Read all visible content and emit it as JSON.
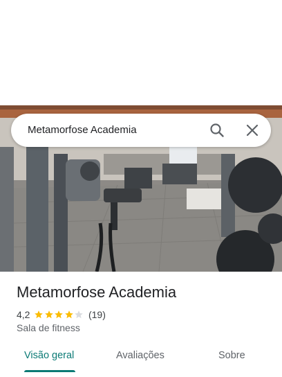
{
  "search": {
    "query": "Metamorfose Academia"
  },
  "place": {
    "name": "Metamorfose Academia",
    "rating": "4,2",
    "stars_filled": 4,
    "stars_total": 5,
    "review_count": "(19)",
    "category": "Sala de fitness"
  },
  "tabs": [
    {
      "label": "Visão geral",
      "active": true
    },
    {
      "label": "Avaliações",
      "active": false
    },
    {
      "label": "Sobre",
      "active": false
    }
  ],
  "icons": {
    "search": "search-icon",
    "close": "close-icon",
    "star": "star-icon"
  },
  "colors": {
    "accent": "#0b7a75",
    "star": "#fbbc04",
    "star_empty": "#dadce0"
  }
}
